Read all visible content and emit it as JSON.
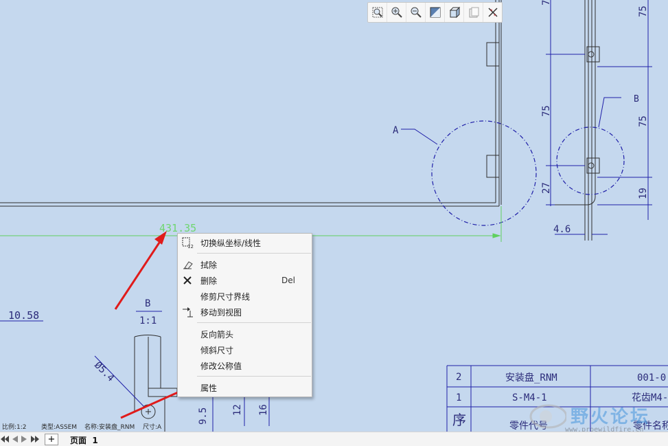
{
  "toolbar": {
    "icons": [
      "zoom-window-icon",
      "zoom-in-icon",
      "zoom-out-icon",
      "display-style-icon",
      "saved-orientations-icon",
      "repaint-icon",
      "datum-display-icon"
    ]
  },
  "drawing": {
    "selected_dim": "431.35",
    "dim_left": "10.58",
    "view_label": "B",
    "view_scale": "1:1",
    "dia_label": "Ø5.4",
    "dim_9_5": "9.5",
    "dim_12": "12",
    "dim_16": "16",
    "callout_a": "A",
    "callout_b": "B",
    "dim_75_top": "75",
    "dim_75_mid": "75",
    "dim_27": "27",
    "dim_75_right_top": "75",
    "dim_75_right_mid": "75",
    "dim_19": "19",
    "dim_4_6": "4.6"
  },
  "bom": {
    "rows": [
      {
        "no": "2",
        "code": "安装盘_RNM",
        "name": "001-0"
      },
      {
        "no": "1",
        "code": "S-M4-1",
        "name": "花齿M4-"
      },
      {
        "no": "序",
        "code": "零件代号",
        "name": "零件名称"
      }
    ]
  },
  "context_menu": {
    "toggle": "切换纵坐标/线性",
    "erase": "拭除",
    "delete": "删除",
    "delete_shortcut": "Del",
    "trim_witness": "修剪尺寸界线",
    "move_to_view": "移动到视图",
    "flip_arrows": "反向箭头",
    "slant_dim": "倾斜尺寸",
    "modify_nominal": "修改公称值",
    "properties": "属性"
  },
  "status": {
    "scale": "比例:1:2",
    "type": "类型:ASSEM",
    "name": "名称:安装盘_RNM",
    "size": "尺寸:A"
  },
  "pagebar": {
    "page_label": "页面",
    "page_number": "1",
    "add": "+"
  },
  "watermark": {
    "title": "野火论坛",
    "url": "www.proewildfire.cn"
  },
  "colors": {
    "background": "#c5d8ee",
    "dimension": "#1f1fa8",
    "geometry": "#2b2b2b",
    "selected": "#6fd66f",
    "annotation_arrow": "#e01b1b"
  }
}
